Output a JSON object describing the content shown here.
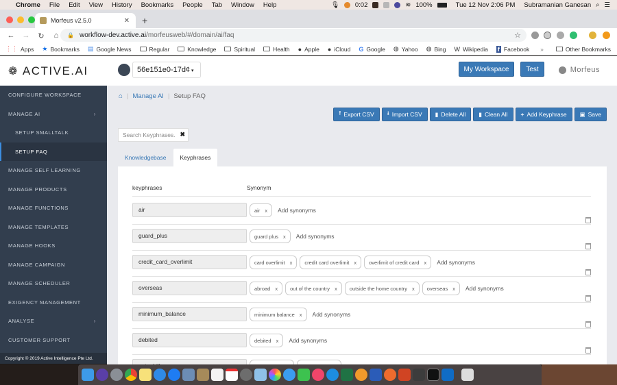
{
  "macos_menubar": {
    "app_name": "Chrome",
    "menus": [
      "File",
      "Edit",
      "View",
      "History",
      "Bookmarks",
      "People",
      "Tab",
      "Window",
      "Help"
    ],
    "timer": "0:02",
    "battery": "100%",
    "datetime": "Tue 12 Nov  2:06 PM",
    "user": "Subramanian Ganesan"
  },
  "browser": {
    "tab_title": "Morfeus v2.5.0",
    "url_host": "workflow-dev.active.ai",
    "url_path": "/morfeusweb/#/domain/ai/faq",
    "bookmarks": [
      {
        "label": "Apps",
        "icon": "apps-grid-icon"
      },
      {
        "label": "Bookmarks",
        "icon": "star-icon"
      },
      {
        "label": "Google News",
        "icon": "news-icon"
      },
      {
        "label": "Regular",
        "icon": "folder-icon"
      },
      {
        "label": "Knowledge",
        "icon": "folder-icon"
      },
      {
        "label": "Spiritual",
        "icon": "folder-icon"
      },
      {
        "label": "Health",
        "icon": "folder-icon"
      },
      {
        "label": "Apple",
        "icon": "apple-icon"
      },
      {
        "label": "iCloud",
        "icon": "apple-icon"
      },
      {
        "label": "Google",
        "icon": "google-icon"
      },
      {
        "label": "Yahoo",
        "icon": "globe-icon"
      },
      {
        "label": "Bing",
        "icon": "globe-icon"
      },
      {
        "label": "Wikipedia",
        "icon": "wikipedia-icon"
      },
      {
        "label": "Facebook",
        "icon": "facebook-icon"
      }
    ],
    "overflow": "»",
    "other_bookmarks": "Other Bookmarks"
  },
  "header": {
    "logo": "ACTIVE.AI",
    "workspace_id": "56e151e0-17d¢",
    "my_workspace": "My Workspace",
    "test": "Test",
    "user": "Morfeus"
  },
  "sidebar": {
    "items": [
      {
        "label": "CONFIGURE WORKSPACE"
      },
      {
        "label": "MANAGE AI",
        "chevron": "›"
      },
      {
        "label": "SETUP SMALLTALK"
      },
      {
        "label": "SETUP FAQ"
      },
      {
        "label": "MANAGE SELF LEARNING"
      },
      {
        "label": "MANAGE PRODUCTS"
      },
      {
        "label": "MANAGE FUNCTIONS"
      },
      {
        "label": "MANAGE TEMPLATES"
      },
      {
        "label": "MANAGE HOOKS"
      },
      {
        "label": "MANAGE CAMPAIGN"
      },
      {
        "label": "MANAGE SCHEDULER"
      },
      {
        "label": "EXIGENCY MANAGEMENT"
      },
      {
        "label": "ANALYSE",
        "chevron": "›"
      },
      {
        "label": "CUSTOMER SUPPORT"
      }
    ],
    "copyright": "Copyright © 2019 Active Intelligence Pte Ltd."
  },
  "breadcrumb": {
    "section": "Manage AI",
    "current": "Setup FAQ"
  },
  "toolbar": {
    "export": "Export CSV",
    "import": "Import CSV",
    "delete_all": "Delete All",
    "clean_all": "Clean All",
    "add_keyphrase": "Add Keyphrase",
    "save": "Save"
  },
  "search": {
    "placeholder": "Search Keyphrases."
  },
  "tabs": {
    "knowledgebase": "Knowledgebase",
    "keyphrases": "Keyphrases"
  },
  "table": {
    "col_keyphrases": "keyphrases",
    "col_synonym": "Synonym",
    "add_synonyms_placeholder": "Add synonyms",
    "rows": [
      {
        "keyphrase": "air",
        "synonyms": [
          "air"
        ]
      },
      {
        "keyphrase": "guard_plus",
        "synonyms": [
          "guard plus"
        ]
      },
      {
        "keyphrase": "credit_card_overlimit",
        "synonyms": [
          "card overlimit",
          "credit card overlimit",
          "overlimit of credit card"
        ]
      },
      {
        "keyphrase": "overseas",
        "synonyms": [
          "abroad",
          "out of the country",
          "outside the home country",
          "overseas"
        ]
      },
      {
        "keyphrase": "minimum_balance",
        "synonyms": [
          "minimum balance"
        ]
      },
      {
        "keyphrase": "debited",
        "synonyms": [
          "debited"
        ]
      },
      {
        "keyphrase": "auto_bill",
        "synonyms": [
          "",
          ""
        ]
      }
    ]
  },
  "colors": {
    "primary": "#3a79b6",
    "sidebar_bg": "#323e4e",
    "main_bg": "#e9eaee"
  }
}
